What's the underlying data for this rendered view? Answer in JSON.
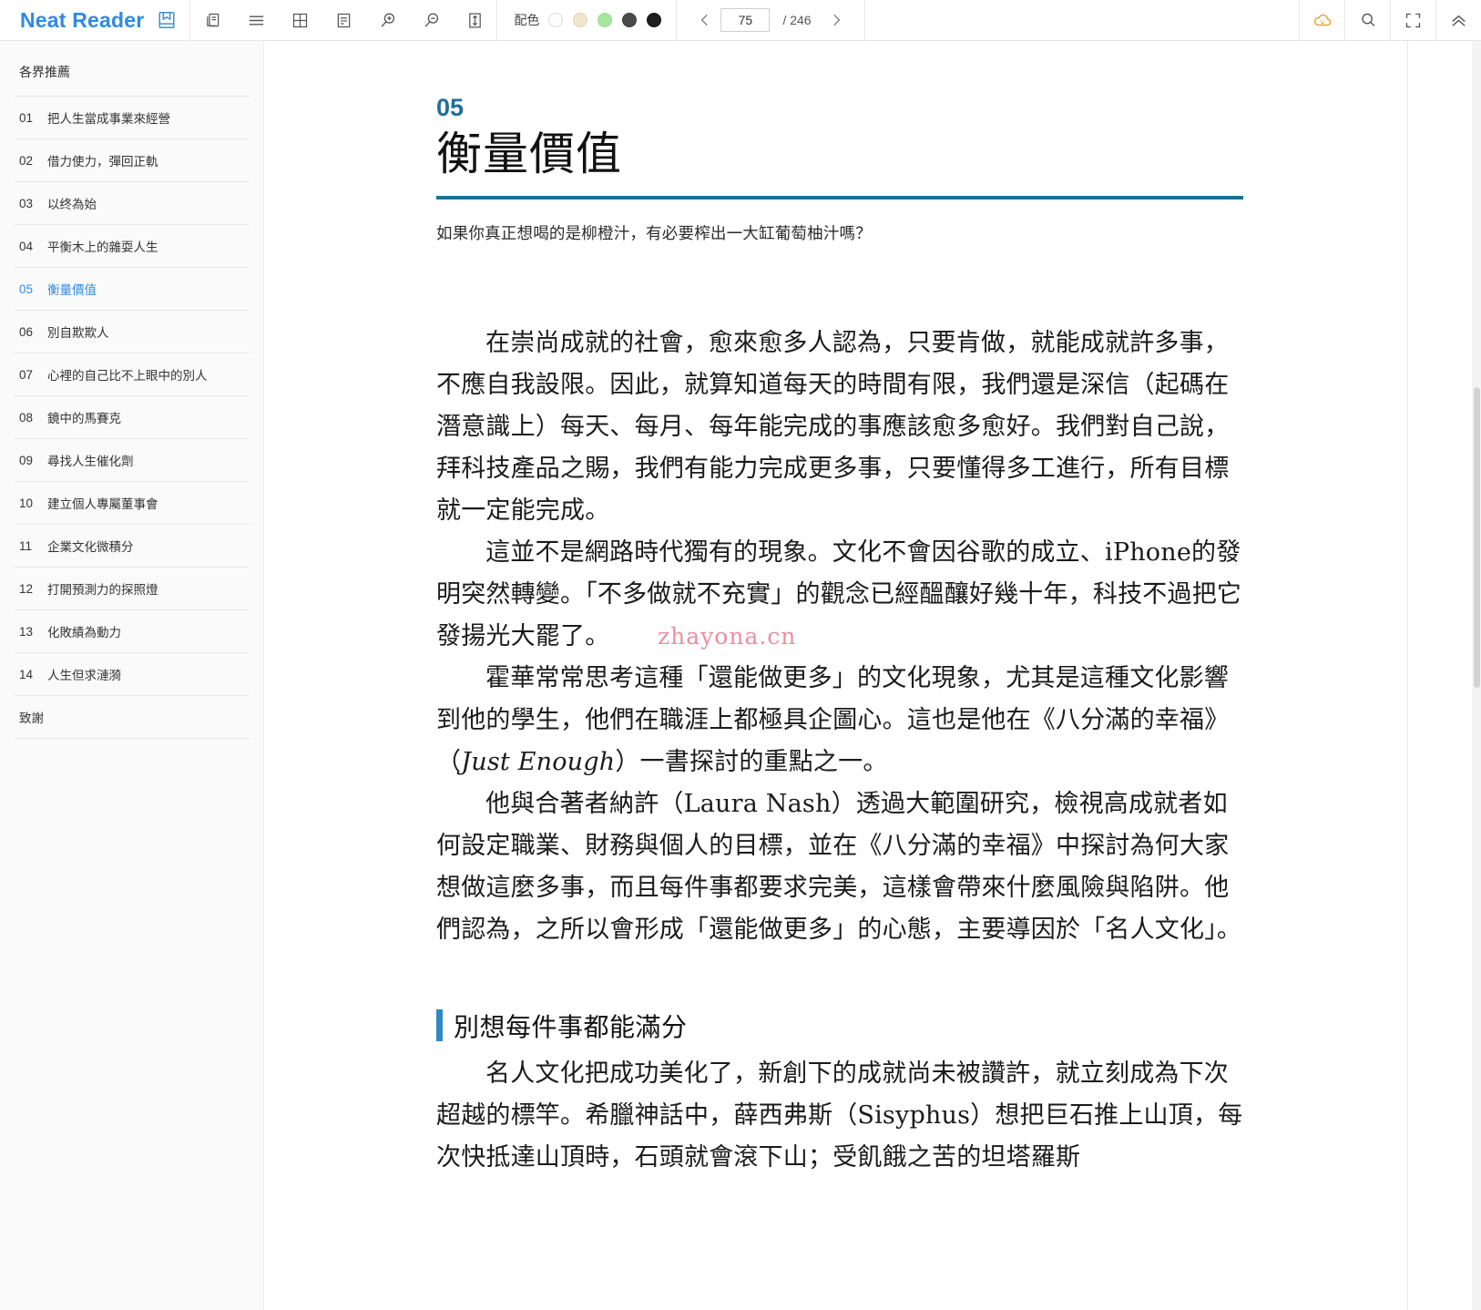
{
  "app": {
    "brand": "Neat Reader",
    "logo_icon": "book-save-icon"
  },
  "toolbar": {
    "buttons": [
      {
        "name": "copy-icon",
        "title": "双页/复制"
      },
      {
        "name": "menu-icon",
        "title": "目录"
      },
      {
        "name": "grid-icon",
        "title": "分栏"
      },
      {
        "name": "note-icon",
        "title": "笔记"
      },
      {
        "name": "zoom-in-icon",
        "title": "放大"
      },
      {
        "name": "zoom-out-icon",
        "title": "缩小"
      },
      {
        "name": "line-height-icon",
        "title": "行距"
      }
    ],
    "theme_label": "配色",
    "themes": [
      {
        "name": "theme-white",
        "color": "#fdfdfd"
      },
      {
        "name": "theme-sepia",
        "color": "#f2e6d0"
      },
      {
        "name": "theme-green",
        "color": "#a8e6a0"
      },
      {
        "name": "theme-gray",
        "color": "#4a4a4a"
      },
      {
        "name": "theme-black",
        "color": "#1e1e1e"
      }
    ],
    "pager": {
      "prev_icon": "chevron-left-icon",
      "next_icon": "chevron-right-icon",
      "current_page": "75",
      "total_label": "/ 246"
    },
    "right_buttons": [
      {
        "name": "cloud-icon",
        "title": "云同步",
        "color": "#e8a33d"
      },
      {
        "name": "search-icon",
        "title": "搜索"
      },
      {
        "name": "fullscreen-icon",
        "title": "全屏"
      },
      {
        "name": "collapse-icon",
        "title": "收起工具栏"
      }
    ]
  },
  "sidebar": {
    "heading": "各界推薦",
    "items": [
      {
        "num": "01",
        "label": "把人生當成事業來經營",
        "active": false
      },
      {
        "num": "02",
        "label": "借力使力，彈回正軌",
        "active": false
      },
      {
        "num": "03",
        "label": "以终為始",
        "active": false
      },
      {
        "num": "04",
        "label": "平衡木上的雜耍人生",
        "active": false
      },
      {
        "num": "05",
        "label": "衡量價值",
        "active": true
      },
      {
        "num": "06",
        "label": "別自欺欺人",
        "active": false
      },
      {
        "num": "07",
        "label": "心裡的自己比不上眼中的別人",
        "active": false
      },
      {
        "num": "08",
        "label": "鏡中的馬賽克",
        "active": false
      },
      {
        "num": "09",
        "label": "尋找人生催化劑",
        "active": false
      },
      {
        "num": "10",
        "label": "建立個人專屬董事會",
        "active": false
      },
      {
        "num": "11",
        "label": "企業文化微積分",
        "active": false
      },
      {
        "num": "12",
        "label": "打開預測力的探照燈",
        "active": false
      },
      {
        "num": "13",
        "label": "化敗績為動力",
        "active": false
      },
      {
        "num": "14",
        "label": "人生但求漣漪",
        "active": false
      }
    ],
    "footer_item": "致謝"
  },
  "document": {
    "chapter_number": "05",
    "chapter_title": "衡量價值",
    "chapter_subtitle": "如果你真正想喝的是柳橙汁，有必要榨出一大缸葡萄柚汁嗎？",
    "paragraph_1": "在崇尚成就的社會，愈來愈多人認為，只要肯做，就能成就許多事，不應自我設限。因此，就算知道每天的時間有限，我們還是深信（起碼在潛意識上）每天、每月、每年能完成的事應該愈多愈好。我們對自己說，拜科技產品之賜，我們有能力完成更多事，只要懂得多工進行，所有目標就一定能完成。",
    "paragraph_2": "這並不是網路時代獨有的現象。文化不會因谷歌的成立、iPhone的發明突然轉變。「不多做就不充實」的觀念已經醞釀好幾十年，科技不過把它發揚光大罷了。",
    "paragraph_3_part1": "霍華常常思考這種「還能做更多」的文化現象，尤其是這種文化影響到他的學生，他們在職涯上都極具企圖心。這也是他在《八分滿的幸福》（",
    "paragraph_3_italic": "Just Enough",
    "paragraph_3_part2": "）一書探討的重點之一。",
    "paragraph_4": "他與合著者納許（Laura Nash）透過大範圍研究，檢視高成就者如何設定職業、財務與個人的目標，並在《八分滿的幸福》中探討為何大家想做這麼多事，而且每件事都要求完美，這樣會帶來什麼風險與陷阱。他們認為，之所以會形成「還能做更多」的心態，主要導因於「名人文化」。",
    "section_title": "別想每件事都能滿分",
    "paragraph_5": "名人文化把成功美化了，新創下的成就尚未被讚許，就立刻成為下次超越的標竿。希臘神話中，薛西弗斯（Sisyphus）想把巨石推上山頂，每次快抵達山頂時，石頭就會滾下山；受飢餓之苦的坦塔羅斯",
    "watermark": "zhayona.cn"
  },
  "colors": {
    "brand": "#2e8ae6",
    "chapter_number": "#1f6f9b",
    "chapter_rule": "#1b7195",
    "section_bar": "#2e8ac6",
    "watermark": "#e87b8d",
    "cloud": "#e8a33d"
  }
}
